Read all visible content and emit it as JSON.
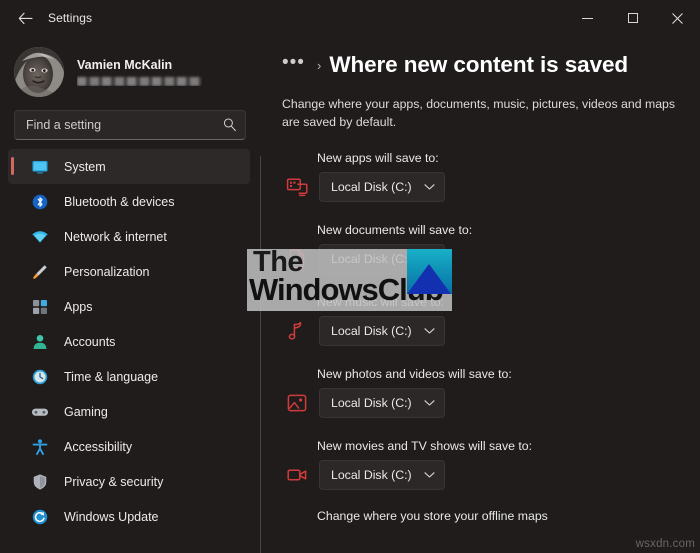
{
  "window": {
    "title": "Settings",
    "back_icon": "back-arrow-icon",
    "controls": {
      "minimize": "minimize-icon",
      "maximize": "maximize-icon",
      "close": "close-icon"
    }
  },
  "sidebar": {
    "profile": {
      "name": "Vamien McKalin",
      "email_redacted": "",
      "avatar": "user-avatar-photo"
    },
    "search": {
      "placeholder": "Find a setting",
      "value": "",
      "icon": "search-icon"
    },
    "items": [
      {
        "label": "System",
        "icon": "monitor-icon",
        "active": true
      },
      {
        "label": "Bluetooth & devices",
        "icon": "bluetooth-icon",
        "active": false
      },
      {
        "label": "Network & internet",
        "icon": "wifi-icon",
        "active": false
      },
      {
        "label": "Personalization",
        "icon": "paintbrush-icon",
        "active": false
      },
      {
        "label": "Apps",
        "icon": "apps-grid-icon",
        "active": false
      },
      {
        "label": "Accounts",
        "icon": "person-icon",
        "active": false
      },
      {
        "label": "Time & language",
        "icon": "clock-icon",
        "active": false
      },
      {
        "label": "Gaming",
        "icon": "gamepad-icon",
        "active": false
      },
      {
        "label": "Accessibility",
        "icon": "accessibility-icon",
        "active": false
      },
      {
        "label": "Privacy & security",
        "icon": "shield-icon",
        "active": false
      },
      {
        "label": "Windows Update",
        "icon": "update-icon",
        "active": false
      }
    ]
  },
  "main": {
    "breadcrumb": {
      "overflow": "•••",
      "separator": "›",
      "title": "Where new content is saved"
    },
    "subtitle": "Change where your apps, documents, music, pictures, videos and maps are saved by default.",
    "rows": [
      {
        "label": "New apps will save to:",
        "icon": "app-window-icon",
        "value": "Local Disk (C:)",
        "chevron": "chevron-down-icon"
      },
      {
        "label": "New documents will save to:",
        "icon": "document-icon",
        "value": "Local Disk (C:)",
        "chevron": "chevron-down-icon"
      },
      {
        "label": "New music will save to:",
        "icon": "music-note-icon",
        "value": "Local Disk (C:)",
        "chevron": "chevron-down-icon"
      },
      {
        "label": "New photos and videos will save to:",
        "icon": "photo-icon",
        "value": "Local Disk (C:)",
        "chevron": "chevron-down-icon"
      },
      {
        "label": "New movies and TV shows will save to:",
        "icon": "video-camera-icon",
        "value": "Local Disk (C:)",
        "chevron": "chevron-down-icon"
      }
    ],
    "footer_note": "Change where you store your offline maps"
  },
  "watermarks": {
    "overlay_line1": "The",
    "overlay_line2": "WindowsClub",
    "overlay_logo": "windowsclub-logo",
    "corner": "wsxdn.com"
  },
  "colors": {
    "window_bg": "#201c1c",
    "accent_bar": "#d4685f",
    "row_icon": "#d13b3b",
    "dropdown_bg": "#2c2828",
    "text_primary": "#ffffff"
  }
}
